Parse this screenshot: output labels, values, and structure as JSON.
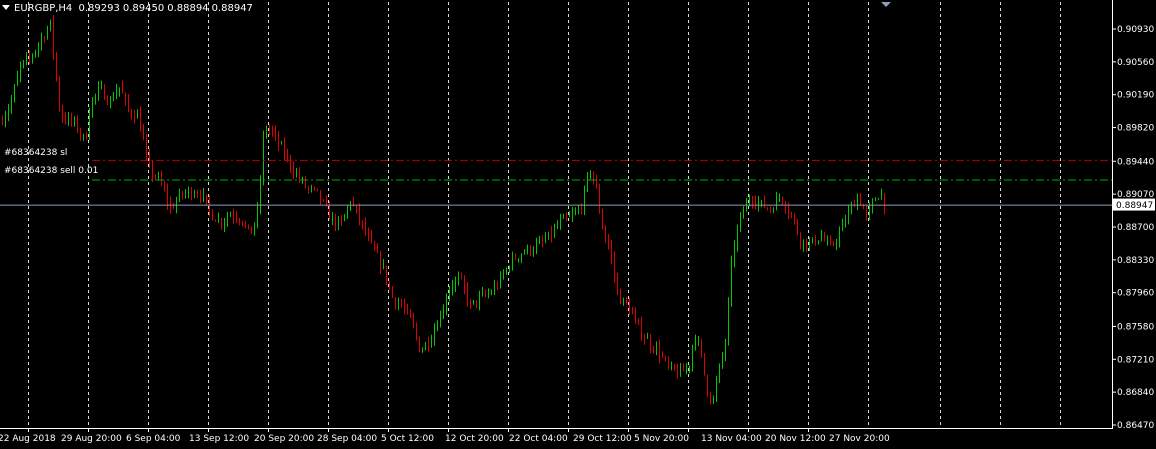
{
  "symbol_header": {
    "symbol_timeframe": "EURGBP,H4",
    "open": "0.89293",
    "high": "0.89450",
    "low": "0.88894",
    "close": "0.88947"
  },
  "orders": {
    "sl_label": "#68364238 sl",
    "entry_label": "#68364238 sell 0.01"
  },
  "colors": {
    "background": "#000000",
    "bull": "#00c800",
    "bear": "#e00000",
    "grid": "#ffffff",
    "sl_line": "#c00000",
    "entry_line": "#00b000",
    "bid_line": "#8c9dbc",
    "axis_text": "#ffffff"
  },
  "chart_data": {
    "type": "candlestick",
    "symbol": "EURGBP",
    "timeframe": "H4",
    "price_axis_ticks": [
      "0.90930",
      "0.90560",
      "0.90190",
      "0.89820",
      "0.89440",
      "0.89070",
      "0.88700",
      "0.88330",
      "0.87960",
      "0.87580",
      "0.87210",
      "0.86840",
      "0.86470"
    ],
    "ylim": [
      0.8642,
      0.9125
    ],
    "time_axis_labels": [
      "22 Aug 2018",
      "29 Aug 20:00",
      "6 Sep 04:00",
      "13 Sep 12:00",
      "20 Sep 20:00",
      "28 Sep 04:00",
      "5 Oct 12:00",
      "12 Oct 20:00",
      "22 Oct 04:00",
      "29 Oct 12:00",
      "5 Nov 20:00",
      "13 Nov 04:00",
      "20 Nov 12:00",
      "27 Nov 20:00"
    ],
    "current_price": "0.88947",
    "order_lines": [
      {
        "label": "#68364238 sl",
        "price": 0.8945
      },
      {
        "label": "#68364238 sell 0.01",
        "price": 0.8923
      }
    ],
    "close_path": [
      [
        0,
        0.8988
      ],
      [
        10,
        0.9008
      ],
      [
        20,
        0.905
      ],
      [
        30,
        0.906
      ],
      [
        40,
        0.908
      ],
      [
        50,
        0.9098
      ],
      [
        60,
        0.8995
      ],
      [
        75,
        0.8985
      ],
      [
        85,
        0.8965
      ],
      [
        90,
        0.901
      ],
      [
        100,
        0.9025
      ],
      [
        110,
        0.901
      ],
      [
        118,
        0.903
      ],
      [
        128,
        0.9
      ],
      [
        138,
        0.8995
      ],
      [
        148,
        0.8935
      ],
      [
        160,
        0.892
      ],
      [
        170,
        0.889
      ],
      [
        180,
        0.8905
      ],
      [
        190,
        0.891
      ],
      [
        200,
        0.8908
      ],
      [
        210,
        0.8885
      ],
      [
        220,
        0.8875
      ],
      [
        230,
        0.8885
      ],
      [
        240,
        0.888
      ],
      [
        250,
        0.886
      ],
      [
        258,
        0.889
      ],
      [
        264,
        0.8985
      ],
      [
        272,
        0.8975
      ],
      [
        285,
        0.895
      ],
      [
        295,
        0.893
      ],
      [
        305,
        0.8915
      ],
      [
        318,
        0.8905
      ],
      [
        330,
        0.888
      ],
      [
        340,
        0.887
      ],
      [
        350,
        0.89
      ],
      [
        362,
        0.887
      ],
      [
        372,
        0.8845
      ],
      [
        382,
        0.8825
      ],
      [
        392,
        0.879
      ],
      [
        402,
        0.878
      ],
      [
        412,
        0.876
      ],
      [
        420,
        0.873
      ],
      [
        430,
        0.8745
      ],
      [
        440,
        0.877
      ],
      [
        450,
        0.8805
      ],
      [
        460,
        0.881
      ],
      [
        470,
        0.878
      ],
      [
        480,
        0.879
      ],
      [
        490,
        0.8795
      ],
      [
        500,
        0.881
      ],
      [
        510,
        0.883
      ],
      [
        520,
        0.884
      ],
      [
        530,
        0.8845
      ],
      [
        540,
        0.885
      ],
      [
        550,
        0.886
      ],
      [
        560,
        0.8875
      ],
      [
        570,
        0.888
      ],
      [
        580,
        0.889
      ],
      [
        590,
        0.8935
      ],
      [
        596,
        0.891
      ],
      [
        602,
        0.887
      ],
      [
        610,
        0.884
      ],
      [
        618,
        0.879
      ],
      [
        628,
        0.878
      ],
      [
        638,
        0.8755
      ],
      [
        648,
        0.874
      ],
      [
        658,
        0.873
      ],
      [
        668,
        0.871
      ],
      [
        678,
        0.8705
      ],
      [
        688,
        0.871
      ],
      [
        694,
        0.875
      ],
      [
        700,
        0.873
      ],
      [
        706,
        0.869
      ],
      [
        712,
        0.867
      ],
      [
        718,
        0.8705
      ],
      [
        725,
        0.874
      ],
      [
        732,
        0.884
      ],
      [
        740,
        0.888
      ],
      [
        750,
        0.8905
      ],
      [
        760,
        0.8895
      ],
      [
        770,
        0.889
      ],
      [
        780,
        0.8905
      ],
      [
        790,
        0.8885
      ],
      [
        800,
        0.8855
      ],
      [
        810,
        0.885
      ],
      [
        820,
        0.886
      ],
      [
        830,
        0.8845
      ],
      [
        840,
        0.8865
      ],
      [
        850,
        0.889
      ],
      [
        858,
        0.8905
      ],
      [
        866,
        0.888
      ],
      [
        874,
        0.89
      ],
      [
        880,
        0.891
      ],
      [
        884,
        0.8895
      ]
    ]
  }
}
